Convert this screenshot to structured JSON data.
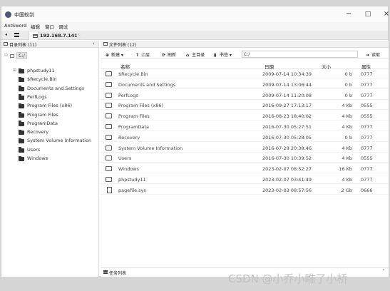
{
  "window": {
    "title": "中国蚁剑",
    "minimize": "−",
    "maximize": "□",
    "close": "×"
  },
  "menu": [
    "AntSword",
    "编辑",
    "窗口",
    "调试"
  ],
  "tabs": {
    "left_arrow": "◂",
    "host": "192.168.7.141"
  },
  "dir_panel": {
    "title": "目录列表 (11)",
    "collapse": "‹",
    "root_toggle": "⊟",
    "root": "C:/",
    "items": [
      {
        "label": "phpstudy11",
        "toggle": "⊞"
      },
      {
        "label": "$Recycle.Bin",
        "toggle": ""
      },
      {
        "label": "Documents and Settings",
        "toggle": ""
      },
      {
        "label": "PerfLogs",
        "toggle": ""
      },
      {
        "label": "Program Files (x86)",
        "toggle": ""
      },
      {
        "label": "Program Files",
        "toggle": ""
      },
      {
        "label": "ProgramData",
        "toggle": ""
      },
      {
        "label": "Recovery",
        "toggle": ""
      },
      {
        "label": "System Volume Information",
        "toggle": ""
      },
      {
        "label": "Users",
        "toggle": ""
      },
      {
        "label": "Windows",
        "toggle": ""
      }
    ]
  },
  "file_panel": {
    "title": "文件列表 (12)",
    "toolbar": {
      "new_icon": "⊕",
      "new": "新建 ▾",
      "up_icon": "↑",
      "up": "上层",
      "refresh_icon": "⟳",
      "refresh": "刷新",
      "home_icon": "⌂",
      "home": "主目录",
      "bookmark_icon": "▮",
      "bookmark": "书签 ▾",
      "path": "C:/",
      "goto_icon": "➜",
      "goto": "读取"
    },
    "columns": {
      "name": "名称",
      "date": "日期",
      "size": "大小",
      "attr": "属性"
    },
    "rows": [
      {
        "type": "folder",
        "name": "$Recycle.Bin",
        "date": "2009-07-14 10:34:39",
        "size": "0 b",
        "attr": "0777"
      },
      {
        "type": "folder",
        "name": "Documents and Settings",
        "date": "2009-07-14 13:06:44",
        "size": "0 b",
        "attr": "0777"
      },
      {
        "type": "folder",
        "name": "PerfLogs",
        "date": "2009-07-14 11:20:08",
        "size": "0 b",
        "attr": "0777"
      },
      {
        "type": "folder",
        "name": "Program Files (x86)",
        "date": "2016-09-27 17:13:17",
        "size": "4 Kb",
        "attr": "0555"
      },
      {
        "type": "folder",
        "name": "Program Files",
        "date": "2016-08-23 18:40:02",
        "size": "4 Kb",
        "attr": "0555"
      },
      {
        "type": "folder",
        "name": "ProgramData",
        "date": "2016-07-30 05:27:51",
        "size": "4 Kb",
        "attr": "0777"
      },
      {
        "type": "folder",
        "name": "Recovery",
        "date": "2016-07-30 05:28:05",
        "size": "0 b",
        "attr": "0777"
      },
      {
        "type": "folder",
        "name": "System Volume Information",
        "date": "2016-07-29 20:38:46",
        "size": "4 Kb",
        "attr": "0777"
      },
      {
        "type": "folder",
        "name": "Users",
        "date": "2016-07-30 10:39:52",
        "size": "4 Kb",
        "attr": "0555"
      },
      {
        "type": "folder",
        "name": "Windows",
        "date": "2023-02-07 08:52:27",
        "size": "16 Kb",
        "attr": "0777"
      },
      {
        "type": "folder",
        "name": "phpstudy11",
        "date": "2023-02-07 03:41:49",
        "size": "4 Kb",
        "attr": "0777"
      },
      {
        "type": "file",
        "name": "pagefile.sys",
        "date": "2023-02-03 08:57:56",
        "size": "2 Gb",
        "attr": "0666"
      }
    ]
  },
  "task_panel": {
    "title": "任务列表",
    "toggle": "˄"
  },
  "watermark": "CSDN @小乔小瞧了小桥"
}
